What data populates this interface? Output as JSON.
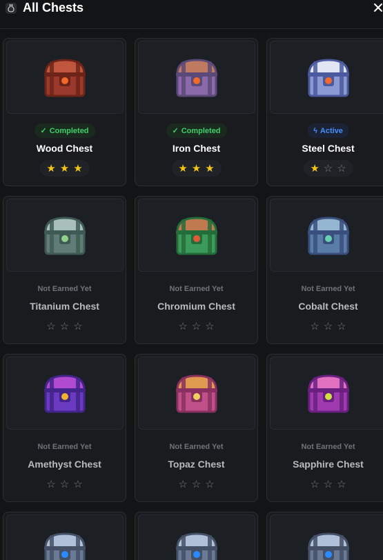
{
  "header": {
    "title": "All Chests",
    "app_icon": "money-bag-icon",
    "close_icon": "close-icon"
  },
  "colors": {
    "completed": "#3fd06a",
    "active": "#4a90ff",
    "star": "#f5c518",
    "background": "#131416"
  },
  "chests": [
    {
      "name": "Wood Chest",
      "status": "Completed",
      "status_type": "completed",
      "stars": 3,
      "palette": [
        "#9b3a2c",
        "#c1563e",
        "#6d2418",
        "#f06a2a"
      ]
    },
    {
      "name": "Iron Chest",
      "status": "Completed",
      "status_type": "completed",
      "stars": 3,
      "palette": [
        "#8a6aa8",
        "#c07a60",
        "#5b4a78",
        "#f06a2a"
      ]
    },
    {
      "name": "Steel Chest",
      "status": "Active",
      "status_type": "active",
      "stars": 1,
      "palette": [
        "#8c9ad4",
        "#e2e6f4",
        "#4b5a9e",
        "#f06a2a"
      ]
    },
    {
      "name": "Titanium Chest",
      "status": "Not Earned Yet",
      "status_type": "locked",
      "stars": 0,
      "palette": [
        "#5f7d76",
        "#a9c0ba",
        "#3f5a55",
        "#8fd08a"
      ]
    },
    {
      "name": "Chromium Chest",
      "status": "Not Earned Yet",
      "status_type": "locked",
      "stars": 0,
      "palette": [
        "#3c9a5a",
        "#c07a50",
        "#236d3b",
        "#e05a3a"
      ]
    },
    {
      "name": "Cobalt Chest",
      "status": "Not Earned Yet",
      "status_type": "locked",
      "stars": 0,
      "palette": [
        "#5a7da8",
        "#94b6d0",
        "#3a4f7d",
        "#66d0b0"
      ]
    },
    {
      "name": "Amethyst Chest",
      "status": "Not Earned Yet",
      "status_type": "locked",
      "stars": 0,
      "palette": [
        "#6a3ac0",
        "#b04ad0",
        "#43248a",
        "#f0b030"
      ]
    },
    {
      "name": "Topaz Chest",
      "status": "Not Earned Yet",
      "status_type": "locked",
      "stars": 0,
      "palette": [
        "#c0508a",
        "#e09a50",
        "#8a3060",
        "#f0d060"
      ]
    },
    {
      "name": "Sapphire Chest",
      "status": "Not Earned Yet",
      "status_type": "locked",
      "stars": 0,
      "palette": [
        "#a03ab0",
        "#e070c0",
        "#6a2080",
        "#d0e040"
      ]
    },
    {
      "name": "",
      "status": "",
      "status_type": "locked",
      "stars": 0,
      "palette": [
        "#6a7a94",
        "#b0c0d8",
        "#445066",
        "#2a8aff"
      ]
    },
    {
      "name": "",
      "status": "",
      "status_type": "locked",
      "stars": 0,
      "palette": [
        "#6a7a94",
        "#b0c0d8",
        "#445066",
        "#2a8aff"
      ]
    },
    {
      "name": "",
      "status": "",
      "status_type": "locked",
      "stars": 0,
      "palette": [
        "#6a7a94",
        "#b0c0d8",
        "#445066",
        "#2a8aff"
      ]
    }
  ]
}
